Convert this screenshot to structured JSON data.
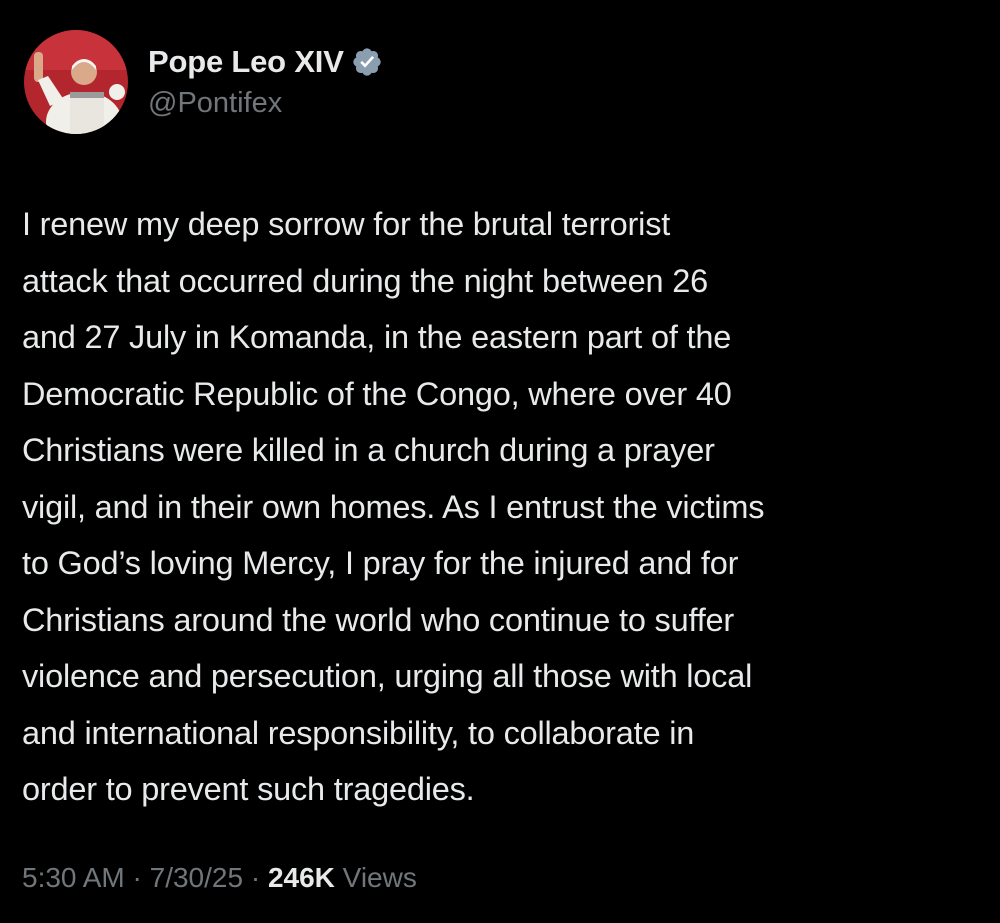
{
  "author": {
    "display_name": "Pope Leo XIV",
    "handle": "@Pontifex",
    "verified_icon": "verified-badge-icon",
    "verified_color": "#8a9eb0"
  },
  "tweet": {
    "text_lines": [
      "I renew my deep sorrow for the brutal terrorist",
      "attack that occurred during the night between 26",
      "and 27 July in Komanda, in the eastern part of the",
      "Democratic Republic of the Congo, where over 40",
      "Christians were killed in a church during a prayer",
      "vigil, and in their own homes. As I entrust the victims",
      "to God’s loving Mercy, I pray for the injured and for",
      "Christians around the world who continue to suffer",
      "violence and persecution, urging all those with local",
      "and international responsibility, to collaborate in",
      "order to prevent such tragedies."
    ]
  },
  "meta": {
    "time": "5:30 AM",
    "separator": " · ",
    "date": "7/30/25",
    "views_count": "246K",
    "views_label": " Views"
  },
  "colors": {
    "background": "#000000",
    "primary_text": "#e7e9ea",
    "secondary_text": "#71767b",
    "avatar_bg": "#b3262e"
  }
}
